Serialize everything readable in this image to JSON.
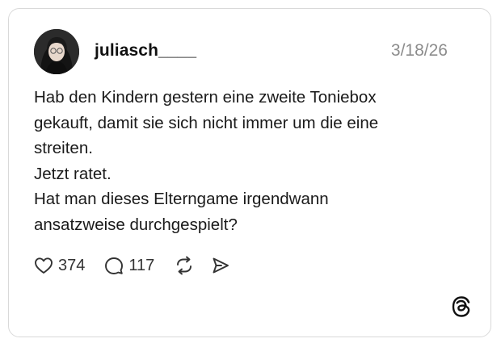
{
  "post": {
    "username": "juliasch____",
    "date": "3/18/26",
    "text_lines": [
      "Hab den Kindern gestern eine zweite Toniebox",
      "gekauft, damit sie sich nicht immer um die eine",
      "streiten.",
      "Jetzt ratet.",
      "Hat man dieses Elterngame irgendwann",
      "ansatzweise durchgespielt?"
    ]
  },
  "actions": {
    "likes": "374",
    "replies": "117"
  },
  "icons": {
    "like": "heart-icon",
    "reply": "speech-bubble-icon",
    "repost": "repost-icon",
    "share": "send-icon",
    "brand": "threads-logo-icon"
  },
  "colors": {
    "border": "#d9d9d9",
    "text": "#1a1a1a",
    "muted": "#8c8c8c"
  }
}
